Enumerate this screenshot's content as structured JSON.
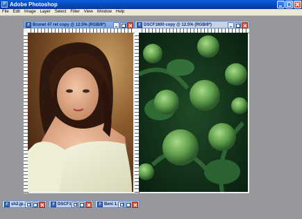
{
  "app": {
    "title": "Adobe Photoshop",
    "icon": "photoshop-app-icon"
  },
  "window_controls": [
    "minimize",
    "maximize",
    "close"
  ],
  "menu": [
    "File",
    "Edit",
    "Image",
    "Layer",
    "Select",
    "Filter",
    "View",
    "Window",
    "Help"
  ],
  "documents": [
    {
      "name": "Brunet 47 ret copy @ 12.5% (RGB/8*)",
      "active": true
    },
    {
      "name": "DSCF1800 copy @ 12.5% (RGB/8*)",
      "active": false
    }
  ],
  "minimized_docs": [
    {
      "name": "sh2.jp..."
    },
    {
      "name": "DSCF1..."
    },
    {
      "name": "Beni 1..."
    }
  ],
  "colors": {
    "workspace": "#97989b",
    "titlebar": "#0546b8",
    "menubar": "#ece9d8",
    "close_red": "#d9573a"
  }
}
